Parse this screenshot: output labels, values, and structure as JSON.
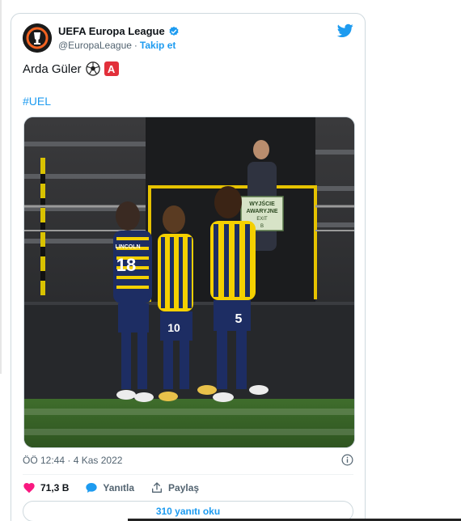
{
  "account": {
    "display_name": "UEFA Europa League",
    "handle": "@EuropaLeague",
    "separator": "·",
    "follow_label": "Takip et"
  },
  "tweet": {
    "text": "Arda Güler",
    "badge_letter": "A",
    "hashtag": "#UEL"
  },
  "media": {
    "sign_line1": "WYJŚCIE",
    "sign_line2": "AWARYJNE",
    "sign_line3": "EXIT",
    "sign_line4": "B",
    "player_left_name": "LINCOLN",
    "player_left_number": "18",
    "player_mid_number": "10",
    "player_right_number": "5"
  },
  "meta": {
    "timestamp": "ÖÖ 12:44 · 4 Kas 2022"
  },
  "actions": {
    "like_count": "71,3 B",
    "reply_label": "Yanıtla",
    "share_label": "Paylaş"
  },
  "footer": {
    "read_replies_label": "310 yanıtı oku"
  },
  "colors": {
    "accent": "#1d9bf0",
    "like": "#f91880",
    "badge": "#e2303b",
    "text_secondary": "#536471"
  },
  "icons": [
    "uel-logo-icon",
    "verified-icon",
    "twitter-bird-icon",
    "soccer-ball-icon",
    "info-icon",
    "heart-icon",
    "reply-bubble-icon",
    "share-icon"
  ]
}
